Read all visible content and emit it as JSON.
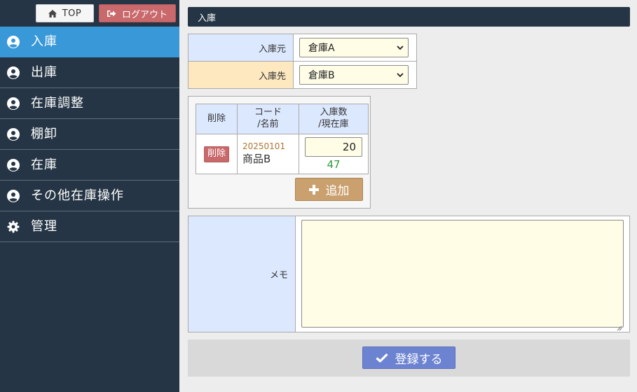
{
  "header": {
    "top_label": "TOP",
    "logout_label": "ログアウト"
  },
  "nav": {
    "items": [
      {
        "label": "入庫",
        "icon": "user-circle-icon",
        "active": true
      },
      {
        "label": "出庫",
        "icon": "user-circle-icon"
      },
      {
        "label": "在庫調整",
        "icon": "user-circle-icon"
      },
      {
        "label": "棚卸",
        "icon": "user-circle-icon"
      },
      {
        "label": "在庫",
        "icon": "user-circle-icon"
      },
      {
        "label": "その他在庫操作",
        "icon": "user-circle-icon"
      },
      {
        "label": "管理",
        "icon": "gear-icon"
      }
    ]
  },
  "page": {
    "title": "入庫"
  },
  "route": {
    "from_label": "入庫元",
    "from_value": "倉庫A",
    "to_label": "入庫先",
    "to_value": "倉庫B"
  },
  "items": {
    "headers": {
      "delete": "削除",
      "code_line1": "コード",
      "code_line2": "/名前",
      "qty_line1": "入庫数",
      "qty_line2": "/現在庫"
    },
    "rows": [
      {
        "delete_label": "削除",
        "code": "20250101",
        "name": "商品B",
        "quantity": "20",
        "stock": "47"
      }
    ],
    "add_label": "追加"
  },
  "memo": {
    "label": "メモ",
    "value": ""
  },
  "submit": {
    "label": "登録する"
  },
  "colors": {
    "sidebar": "#253545",
    "active": "#3898d8",
    "logout": "#c9696c",
    "add": "#c9a06e",
    "submit": "#6c83d1",
    "from_bg": "#dce8fe",
    "to_bg": "#fde8c0",
    "input_bg": "#fffde6"
  }
}
